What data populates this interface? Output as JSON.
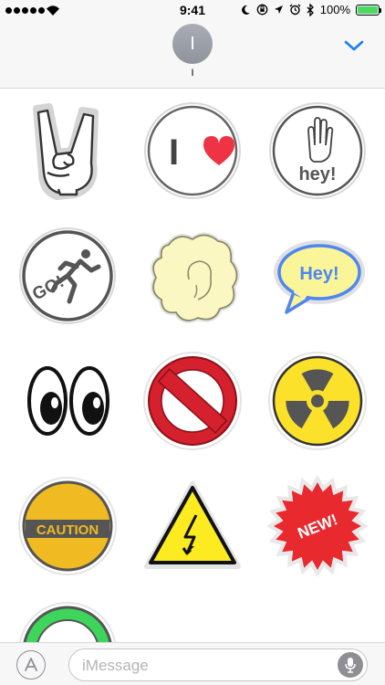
{
  "status_bar": {
    "time": "9:41",
    "battery_text": "100%",
    "battery_level": 1.0,
    "signal_bars": 5,
    "icons": [
      "moon-icon",
      "rotation-lock-icon",
      "location-icon",
      "alarm-icon",
      "bluetooth-icon"
    ]
  },
  "header": {
    "avatar_initial": "I",
    "contact_name": "I",
    "accent_color": "#1a7cf5"
  },
  "stickers": [
    {
      "name": "rock-on-hand"
    },
    {
      "name": "i-love",
      "text": "I"
    },
    {
      "name": "hey-hand",
      "text": "hey!"
    },
    {
      "name": "go-runner",
      "text": "GO!"
    },
    {
      "name": "popcorn"
    },
    {
      "name": "hey-speech-bubble",
      "text": "Hey!"
    },
    {
      "name": "cartoon-eyes"
    },
    {
      "name": "no-sign"
    },
    {
      "name": "radiation-sign"
    },
    {
      "name": "caution-sign",
      "text": "CAUTION"
    },
    {
      "name": "high-voltage-sign"
    },
    {
      "name": "new-burst",
      "text": "NEW!"
    },
    {
      "name": "green-ring"
    }
  ],
  "compose": {
    "placeholder": "iMessage"
  }
}
